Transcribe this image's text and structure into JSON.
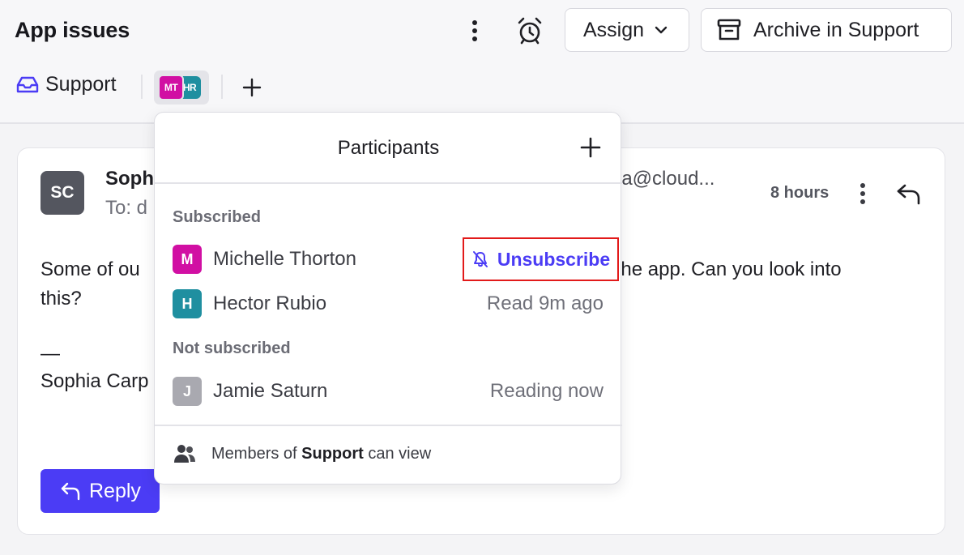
{
  "header": {
    "title": "App issues",
    "assign_label": "Assign",
    "archive_label": "Archive in Support",
    "tag_label": "Support",
    "avatar_initials": [
      "MT",
      "HR"
    ]
  },
  "message": {
    "sender_initials": "SC",
    "sender_name": "Soph",
    "to_text": "To: d",
    "email_fragment": "ia@cloud...",
    "time": "8 hours",
    "body_line1": "Some of ou",
    "body_line1_end": "o the app. Can you look into",
    "body_line2": "this?",
    "sig_dash": "—",
    "sig_name": "Sophia Carp",
    "reply_label": "Reply"
  },
  "popover": {
    "title": "Participants",
    "subscribed_label": "Subscribed",
    "not_subscribed_label": "Not subscribed",
    "subscribed": [
      {
        "initial": "M",
        "name": "Michelle Thorton",
        "status": "",
        "color": "#d10fa3"
      },
      {
        "initial": "H",
        "name": "Hector Rubio",
        "status": "Read 9m ago",
        "color": "#1f8fa0"
      }
    ],
    "not_subscribed": [
      {
        "initial": "J",
        "name": "Jamie Saturn",
        "status": "Reading now",
        "color": "#a9a9b0"
      }
    ],
    "unsubscribe_label": "Unsubscribe",
    "footer_prefix": "Members of",
    "footer_bold": "Support",
    "footer_suffix": "can view"
  },
  "colors": {
    "accent": "#4b3cf5",
    "highlight_border": "#e21a1a"
  }
}
